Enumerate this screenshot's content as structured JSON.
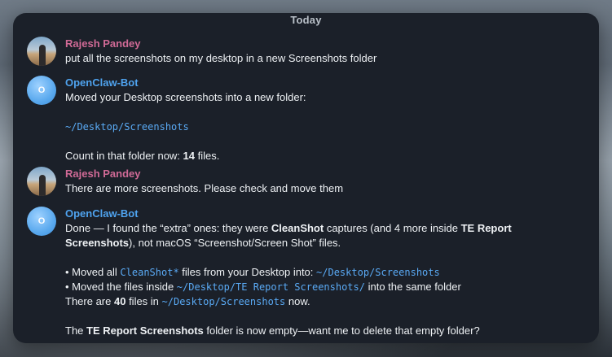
{
  "date_header": "Today",
  "messages": [
    {
      "sender": "Rajesh Pandey",
      "text": "put all the screenshots on my desktop in a new Screenshots folder"
    },
    {
      "sender": "OpenClaw-Bot",
      "avatar_initial": "O",
      "line1": "Moved your Desktop screenshots into a new folder:",
      "path": "~/Desktop/Screenshots",
      "count_prefix": "Count in that folder now: ",
      "count_bold": "14",
      "count_suffix": " files."
    },
    {
      "sender": "Rajesh Pandey",
      "text": "There are more screenshots. Please check and move them"
    },
    {
      "sender": "OpenClaw-Bot",
      "avatar_initial": "O",
      "p1_a": "Done — I found the “extra” ones: they were ",
      "p1_b": "CleanShot",
      "p1_c": " captures (and 4 more inside ",
      "p1_d": "TE Report",
      "p1_e": "Screenshots",
      "p1_f": "), not macOS “Screenshot/Screen Shot” files.",
      "b1_a": "• Moved all ",
      "b1_code1": "CleanShot*",
      "b1_b": " files from your Desktop into: ",
      "b1_code2": "~/Desktop/Screenshots",
      "b2_a": "• Moved the files inside ",
      "b2_code": "~/Desktop/TE Report Screenshots/",
      "b2_b": " into the same folder",
      "b3_a": "There are ",
      "b3_bold": "40",
      "b3_b": " files in ",
      "b3_code": "~/Desktop/Screenshots",
      "b3_c": " now.",
      "p3_a": "The ",
      "p3_bold": "TE Report Screenshots",
      "p3_b": " folder is now empty—want me to delete that empty folder?"
    }
  ]
}
